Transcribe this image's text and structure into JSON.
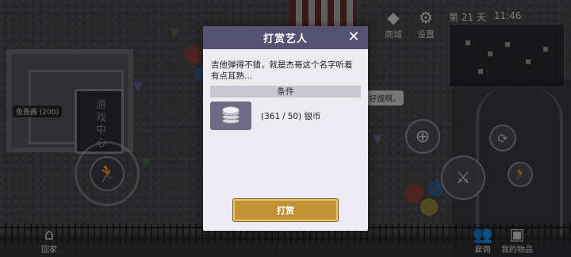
{
  "hud": {
    "shop_label": "商城",
    "settings_label": "设置",
    "day_text": "第 21 天",
    "time_text": "11:46",
    "home_label": "回家",
    "hire_label": "雇佣",
    "items_label": "我的物品",
    "npc_name_tag": "鱼鱼酱 (200)",
    "booth_sign": "游戏中心",
    "speech_bubble": "好饿啊。"
  },
  "dialog": {
    "title": "打赏艺人",
    "description": "吉他弹得不错，就是杰哥这个名字听着有点耳熟...",
    "condition_header": "条件",
    "condition": {
      "item_icon": "silver-coin-icon",
      "current": "361",
      "required": "50",
      "currency": "银币"
    },
    "button_label": "打赏"
  },
  "colors": {
    "header": "#555274",
    "button": "#c29335",
    "panel": "#ecebf1"
  }
}
